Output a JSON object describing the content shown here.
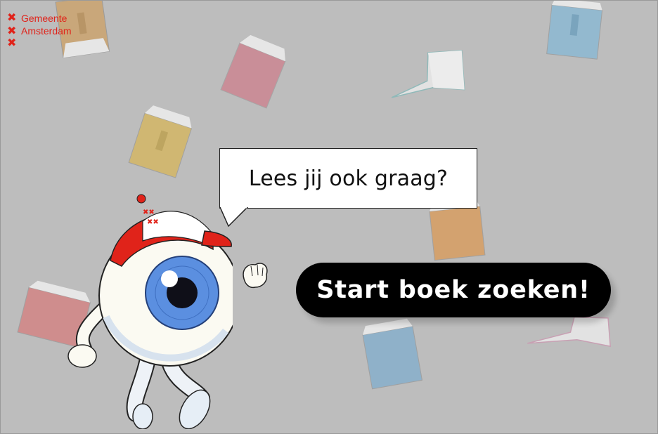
{
  "logo": {
    "marks": [
      "✖",
      "✖",
      "✖"
    ],
    "lines": [
      "Gemeente",
      "Amsterdam"
    ],
    "color": "#e0231a"
  },
  "bubble": {
    "text": "Lees jij ook graag?"
  },
  "start_button": {
    "label": "Start boek zoeken!"
  },
  "colors": {
    "background": "#bdbdbd",
    "button": "#000000",
    "accent": "#e0231a",
    "iris": "#5b8fe0"
  },
  "icons": [
    "book-icon",
    "eye-mascot",
    "cap-icon"
  ]
}
